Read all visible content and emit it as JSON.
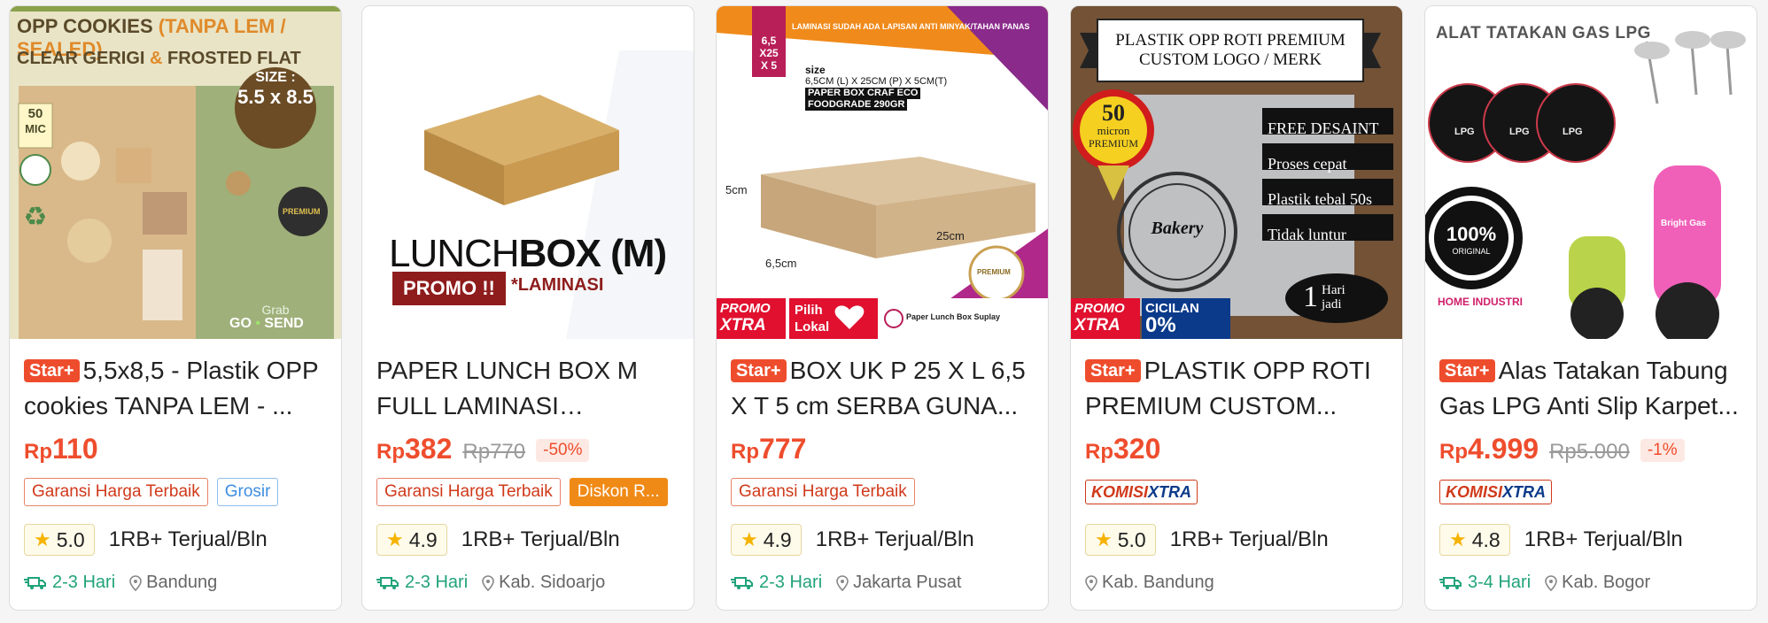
{
  "products": [
    {
      "star": "Star+",
      "title": "5,5x8,5 - Plastik OPP cookies TANPA LEM - ...",
      "currency": "Rp",
      "price": "110",
      "original_price": "",
      "discount": "",
      "tags": [
        {
          "text": "Garansi Harga Terbaik",
          "style": "red"
        },
        {
          "text": "Grosir",
          "style": "blue"
        }
      ],
      "komisi": false,
      "rating": "5.0",
      "sold": "1RB+ Terjual/Bln",
      "shipping": "2-3 Hari",
      "location": "Bandung",
      "image": {
        "headline": "OPP COOKIES",
        "headline_sub": "(TANPA LEM / SEALED)",
        "line2a": "CLEAR GERIGI",
        "line2b": "&",
        "line2c": "FROSTED FLAT",
        "mic": "50",
        "mic_unit": "MIC",
        "size_label": "SIZE :",
        "size_value": "5.5 x 8.5",
        "premium": "PREMIUM",
        "grab1": "Grab",
        "grab2": "GO",
        "grab3": "SEND"
      }
    },
    {
      "star": "",
      "title": "PAPER LUNCH BOX M FULL LAMINASI Lunchbo...",
      "currency": "Rp",
      "price": "382",
      "original_price": "Rp770",
      "discount": "-50%",
      "tags": [
        {
          "text": "Garansi Harga Terbaik",
          "style": "red"
        },
        {
          "text": "Diskon R...",
          "style": "orange"
        }
      ],
      "komisi": false,
      "rating": "4.9",
      "sold": "1RB+ Terjual/Bln",
      "shipping": "2-3 Hari",
      "location": "Kab. Sidoarjo",
      "image": {
        "brand_a": "LUNCH",
        "brand_b": "BOX (M)",
        "promo": "PROMO !!",
        "lam": "*LAMINASI"
      }
    },
    {
      "star": "Star+",
      "title": "BOX UK P 25 X L 6,5 X T 5 cm SERBA GUNA...",
      "currency": "Rp",
      "price": "777",
      "original_price": "",
      "discount": "",
      "tags": [
        {
          "text": "Garansi Harga Terbaik",
          "style": "red"
        }
      ],
      "komisi": false,
      "rating": "4.9",
      "sold": "1RB+ Terjual/Bln",
      "shipping": "2-3 Hari",
      "location": "Jakarta Pusat",
      "image": {
        "top": "LAMINASI SUDAH ADA LAPISAN ANTI MINYAK/TAHAN PANAS",
        "dim1": "6,5",
        "dim2": "X25",
        "dim3": "X 5",
        "size_title": "size",
        "size_text": "6,5CM (L) X 25CM (P) X 5CM(T)",
        "brand": "PAPER BOX CRAF ECO",
        "grade": "FOODGRADE 290GR",
        "h": "5cm",
        "w": "6,5cm",
        "l": "25cm",
        "premium": "PREMIUM",
        "promo1": "PROMO",
        "promo2": "XTRA",
        "pilih1": "Pilih",
        "pilih2": "Lokal",
        "seller": "Paper Lunch Box Suplay"
      }
    },
    {
      "star": "Star+",
      "title": "PLASTIK OPP ROTI PREMIUM CUSTOM...",
      "currency": "Rp",
      "price": "320",
      "original_price": "",
      "discount": "",
      "tags": [],
      "komisi": true,
      "komisi_a": "KOMISI",
      "komisi_b": "XTRA",
      "rating": "5.0",
      "sold": "1RB+ Terjual/Bln",
      "shipping": "",
      "location": "Kab. Bandung",
      "image": {
        "banner1": "PLASTIK OPP ROTI PREMIUM",
        "banner2": "CUSTOM LOGO / MERK",
        "seal_num": "50",
        "seal_a": "micron",
        "seal_b": "PREMIUM",
        "f1": "FREE DESAINT",
        "f2": "Proses cepat",
        "f3": "Plastik tebal 50s",
        "f4": "Tidak luntur",
        "bakery": "Bakery",
        "jadi1": "1",
        "jadi2": "Hari",
        "jadi3": "jadi",
        "promo1": "PROMO",
        "promo2": "XTRA",
        "cicilan1": "CICILAN",
        "cicilan2": "0%"
      }
    },
    {
      "star": "Star+",
      "title": "Alas Tatakan Tabung Gas LPG Anti Slip Karpet...",
      "currency": "Rp",
      "price": "4.999",
      "original_price": "Rp5.000",
      "discount": "-1%",
      "tags": [],
      "komisi": true,
      "komisi_a": "KOMISI",
      "komisi_b": "XTRA",
      "rating": "4.8",
      "sold": "1RB+ Terjual/Bln",
      "shipping": "3-4 Hari",
      "location": "Kab. Bogor",
      "image": {
        "headline": "ALAT TATAKAN GAS LPG",
        "lpg": "LPG",
        "badge_num": "100%",
        "badge_txt": "ORIGINAL",
        "home": "HOME INDUSTRI",
        "bright": "Bright Gas"
      }
    }
  ]
}
